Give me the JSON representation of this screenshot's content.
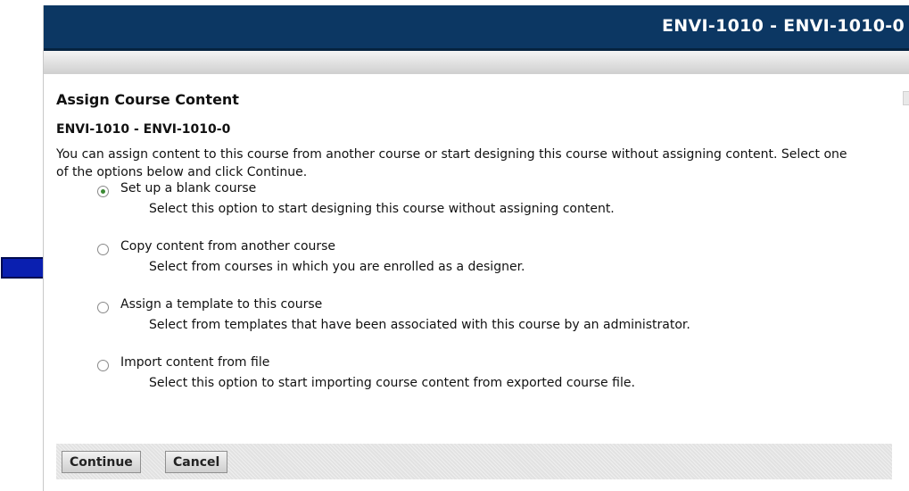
{
  "header": {
    "title": "ENVI-1010 - ENVI-1010-0"
  },
  "page": {
    "title": "Assign Course Content",
    "course": "ENVI-1010 - ENVI-1010-0",
    "intro": "You can assign content to this course from another course or start designing this course without assigning content. Select one of the options below and click Continue."
  },
  "options": [
    {
      "label": "Set up a blank course",
      "description": "Select this option to start designing this course without assigning content.",
      "selected": true
    },
    {
      "label": "Copy content from another course",
      "description": "Select from courses in which you are enrolled as a designer.",
      "selected": false
    },
    {
      "label": "Assign a template to this course",
      "description": "Select from templates that have been associated with this course by an administrator.",
      "selected": false
    },
    {
      "label": "Import content from file",
      "description": "Select this option to start importing course content from exported course file.",
      "selected": false
    }
  ],
  "buttons": {
    "continue": "Continue",
    "cancel": "Cancel"
  },
  "colors": {
    "header_bg": "#0c3763",
    "arrow": "#0a1fb0",
    "radio_selected": "#3c8a35"
  },
  "annotation": {
    "icon": "blue-arrow-icon",
    "points_to_option": 1
  }
}
